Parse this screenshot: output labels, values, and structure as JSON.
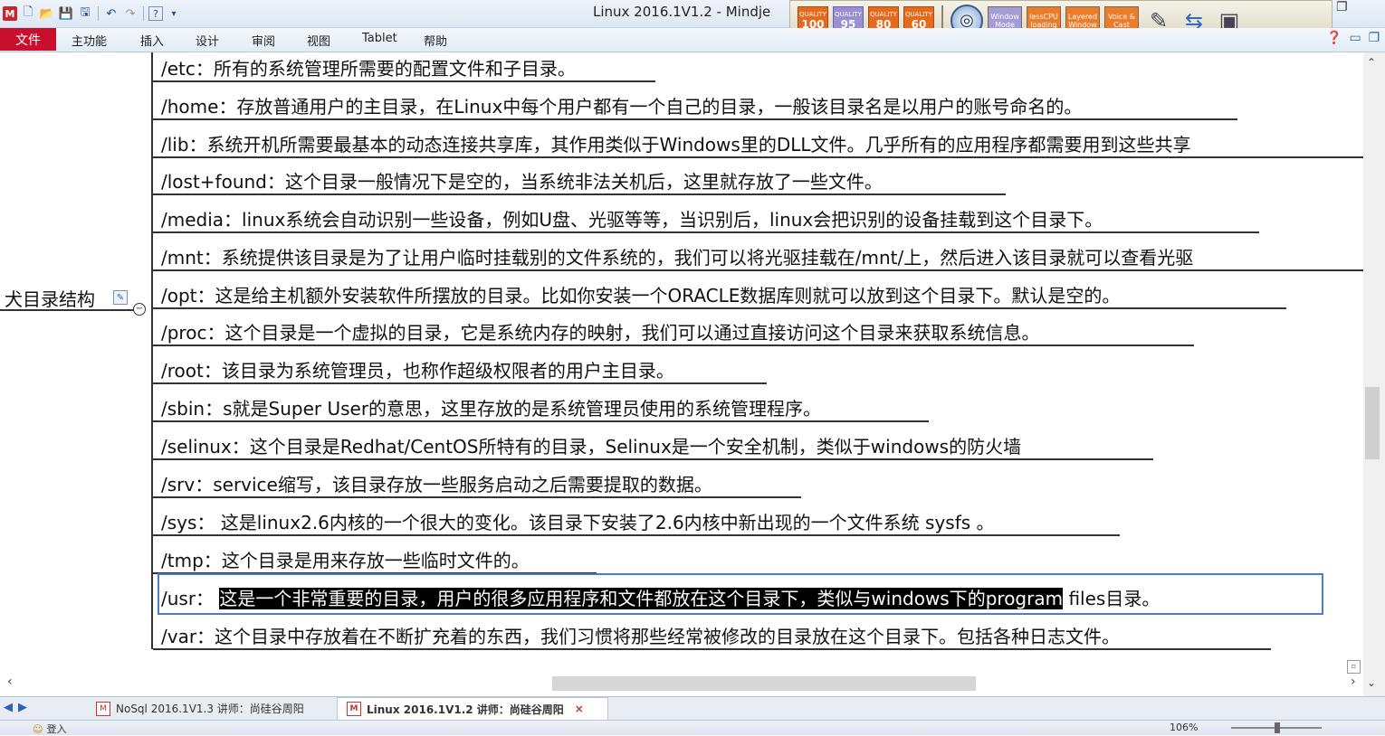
{
  "window": {
    "title": "Linux 2016.1V1.2 - Mindje",
    "controls": [
      "❐",
      "–",
      "✕"
    ]
  },
  "quick_access": {
    "icons": [
      "app-logo",
      "new-file-icon",
      "open-folder-icon",
      "save-icon",
      "save-all-icon",
      "undo-icon",
      "redo-icon",
      "help-icon"
    ],
    "logo_letter": "M"
  },
  "overlay_toolbar": {
    "quality_badges": [
      {
        "label": "QUALITY",
        "value": "100"
      },
      {
        "label": "QUALITY",
        "value": "95"
      },
      {
        "label": "QUALITY",
        "value": "80"
      },
      {
        "label": "QUALITY",
        "value": "60"
      }
    ],
    "modes": [
      "Window Mode",
      "lessCPU loading",
      "Layered Window",
      "Voice & Cast"
    ],
    "tool_icons": [
      "pen-tool-icon",
      "screen-share-icon",
      "capture-icon"
    ]
  },
  "menu": {
    "file": "文件",
    "items": [
      "主功能",
      "插入",
      "设计",
      "审阅",
      "视图",
      "Tablet",
      "帮助"
    ],
    "right_icons": [
      "help-icon",
      "minimize-icon",
      "restore-icon"
    ]
  },
  "mindmap": {
    "parent_label": "犬目录结构",
    "collapse_symbol": "−",
    "topics": [
      {
        "text": "/etc：所有的系统管理所需要的配置文件和子目录。"
      },
      {
        "text": "/home：存放普通用户的主目录，在Linux中每个用户都有一个自己的目录，一般该目录名是以用户的账号命名的。"
      },
      {
        "text": "/lib：系统开机所需要最基本的动态连接共享库，其作用类似于Windows里的DLL文件。几乎所有的应用程序都需要用到这些共享"
      },
      {
        "text": "/lost+found：这个目录一般情况下是空的，当系统非法关机后，这里就存放了一些文件。"
      },
      {
        "text": "/media：linux系统会自动识别一些设备，例如U盘、光驱等等，当识别后，linux会把识别的设备挂载到这个目录下。"
      },
      {
        "text": "/mnt：系统提供该目录是为了让用户临时挂载别的文件系统的，我们可以将光驱挂载在/mnt/上，然后进入该目录就可以查看光驱"
      },
      {
        "text": "/opt：这是给主机额外安装软件所摆放的目录。比如你安装一个ORACLE数据库则就可以放到这个目录下。默认是空的。"
      },
      {
        "text": "/proc：这个目录是一个虚拟的目录，它是系统内存的映射，我们可以通过直接访问这个目录来获取系统信息。"
      },
      {
        "text": "/root：该目录为系统管理员，也称作超级权限者的用户主目录。"
      },
      {
        "text": "/sbin：s就是Super User的意思，这里存放的是系统管理员使用的系统管理程序。"
      },
      {
        "text": "/selinux：这个目录是Redhat/CentOS所特有的目录，Selinux是一个安全机制，类似于windows的防火墙"
      },
      {
        "text": "/srv：service缩写，该目录存放一些服务启动之后需要提取的数据。"
      },
      {
        "text": "/sys： 这是linux2.6内核的一个很大的变化。该目录下安装了2.6内核中新出现的一个文件系统 sysfs 。"
      },
      {
        "text": "/tmp：这个目录是用来存放一些临时文件的。"
      }
    ],
    "selected_topic": {
      "prefix": "/usr： ",
      "highlighted": "这是一个非常重要的目录，用户的很多应用程序和文件都放在这个目录下，类似与windows下的program",
      "suffix": " files目录。"
    },
    "last_topic": {
      "text": "/var：这个目录中存放着在不断扩充着的东西，我们习惯将那些经常被修改的目录放在这个目录下。包括各种日志文件。"
    }
  },
  "tabs": [
    {
      "label": "NoSql 2016.1V1.3 讲师：尚硅谷周阳",
      "active": false
    },
    {
      "label": "Linux 2016.1V1.2 讲师：尚硅谷周阳",
      "active": true
    }
  ],
  "status": {
    "login": "登入",
    "zoom": "106%"
  }
}
